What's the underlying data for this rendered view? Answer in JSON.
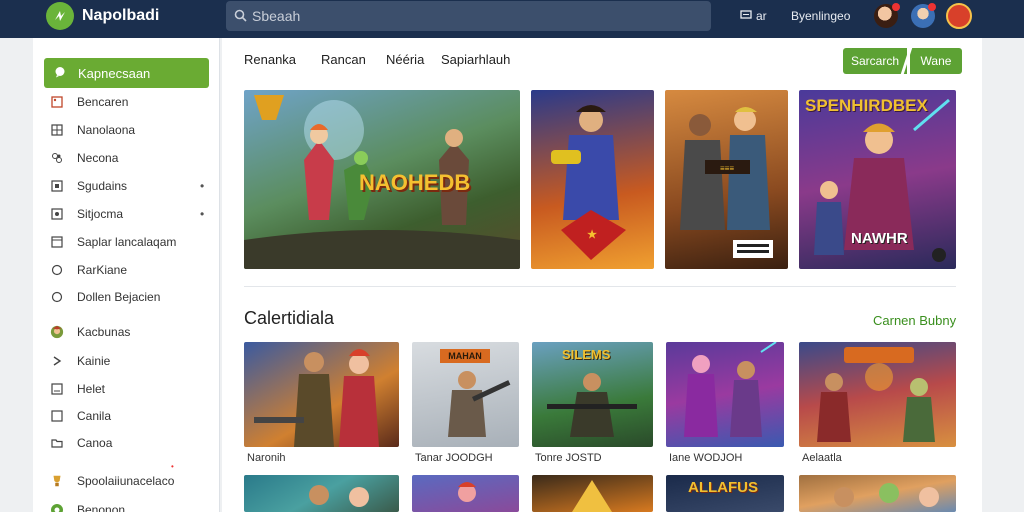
{
  "app": {
    "name": "Napolbadi"
  },
  "search": {
    "placeholder": "Sbeaah"
  },
  "topbar": {
    "action_a": "ar",
    "action_b": "Byenlingeo"
  },
  "colors": {
    "topbar": "#1b2f4e",
    "accent_green": "#6aab33"
  },
  "sidebar": {
    "active": {
      "label": "Kapnecsaan",
      "icon": "chat-bubble-icon"
    },
    "items": [
      {
        "label": "Bencaren",
        "icon": "image-icon"
      },
      {
        "label": "Nanolaona",
        "icon": "grid-icon"
      },
      {
        "label": "Necona",
        "icon": "puzzle-icon"
      },
      {
        "label": "Sgudains",
        "icon": "square-icon",
        "has_dot": true
      },
      {
        "label": "Sitjocma",
        "icon": "square-icon",
        "has_dot": true
      },
      {
        "label": "Saplar lancalaqam",
        "icon": "window-icon"
      },
      {
        "label": "RarKiane",
        "icon": "circle-icon"
      },
      {
        "label": "Dollen Bejacien",
        "icon": "circle-icon"
      },
      {
        "label": "Kacbunas",
        "icon": "game-avatar-icon"
      },
      {
        "label": "Kainie",
        "icon": "chevron-icon"
      },
      {
        "label": "Helet",
        "icon": "square-icon"
      },
      {
        "label": "Canila",
        "icon": "square-icon"
      },
      {
        "label": "Canoa",
        "icon": "folder-icon"
      },
      {
        "label": "Spoolaiiunacelaco",
        "icon": "trophy-icon"
      },
      {
        "label": "Benonon",
        "icon": "green-circle-icon"
      }
    ]
  },
  "tabs": [
    "Renanka",
    "Rancan",
    "Nééria",
    "Sapiarhlauh"
  ],
  "header_buttons": {
    "left": "Sarcarch",
    "right": "Wane"
  },
  "featured": [
    {
      "title": "NAOHEDB",
      "icon": "game-art-featured"
    },
    {
      "title": "",
      "icon": "game-art-hero"
    },
    {
      "title": "",
      "icon": "game-art-soldier"
    },
    {
      "title": "SPENHIRDBEX",
      "subtitle": "NAWHR",
      "icon": "game-art-warrior"
    }
  ],
  "section": {
    "title": "Calertidiala",
    "link": "Carnen Bubny"
  },
  "grid": [
    {
      "caption": "Naronih",
      "title": ""
    },
    {
      "caption": "Tanar  JOODGH",
      "title": "MAHAN"
    },
    {
      "caption": "Tonre  JOSTD",
      "title": "SILEMS"
    },
    {
      "caption": "Iane  WODJOH",
      "title": ""
    },
    {
      "caption": "Aelaatla",
      "title": ""
    }
  ],
  "grid_row2": [
    {
      "title": ""
    },
    {
      "title": ""
    },
    {
      "title": ""
    },
    {
      "title": "ALLAFUS"
    },
    {
      "title": ""
    }
  ]
}
